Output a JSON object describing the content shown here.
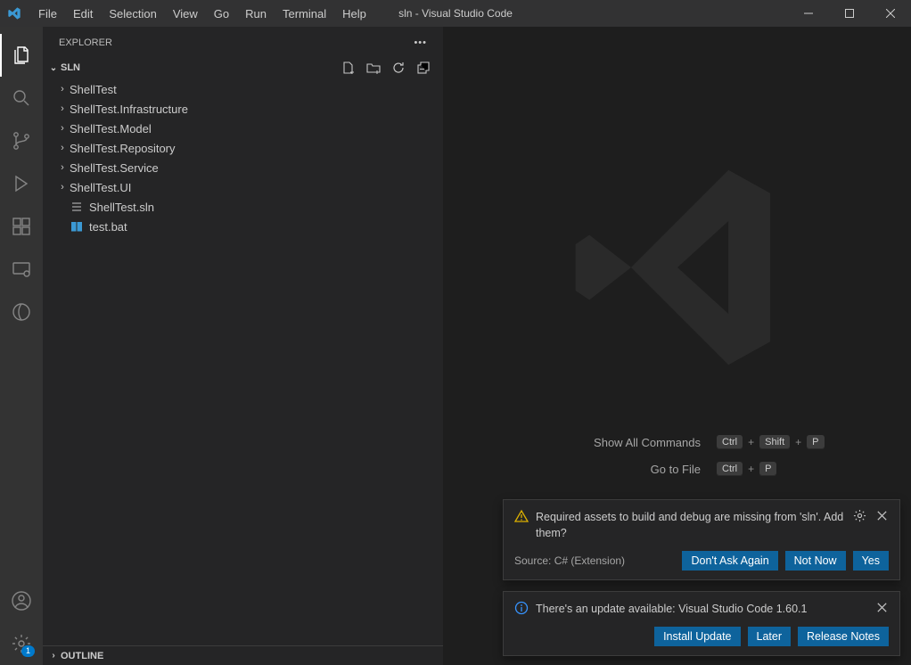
{
  "titlebar": {
    "title": "sln - Visual Studio Code",
    "menu": [
      "File",
      "Edit",
      "Selection",
      "View",
      "Go",
      "Run",
      "Terminal",
      "Help"
    ]
  },
  "activitybar": {
    "settingsBadge": "1"
  },
  "sidebar": {
    "title": "EXPLORER",
    "section": "SLN",
    "folders": [
      "ShellTest",
      "ShellTest.Infrastructure",
      "ShellTest.Model",
      "ShellTest.Repository",
      "ShellTest.Service",
      "ShellTest.UI"
    ],
    "files": [
      {
        "name": "ShellTest.sln",
        "icon": "sln"
      },
      {
        "name": "test.bat",
        "icon": "bat"
      }
    ],
    "outline": "OUTLINE"
  },
  "welcome": {
    "items": [
      {
        "label": "Show All Commands",
        "keys": [
          "Ctrl",
          "Shift",
          "P"
        ]
      },
      {
        "label": "Go to File",
        "keys": [
          "Ctrl",
          "P"
        ]
      }
    ]
  },
  "notifications": [
    {
      "type": "warning",
      "message": "Required assets to build and debug are missing from 'sln'. Add them?",
      "source": "Source: C# (Extension)",
      "hasGear": true,
      "buttons": [
        "Don't Ask Again",
        "Not Now",
        "Yes"
      ]
    },
    {
      "type": "info",
      "message": "There's an update available: Visual Studio Code 1.60.1",
      "source": "",
      "hasGear": false,
      "buttons": [
        "Install Update",
        "Later",
        "Release Notes"
      ]
    }
  ]
}
